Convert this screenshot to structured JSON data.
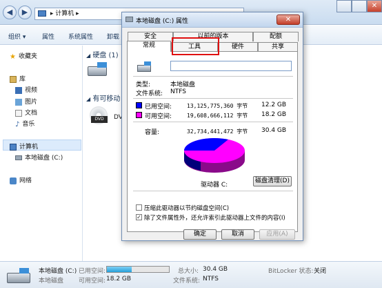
{
  "explorer": {
    "address": {
      "computer": "计算机",
      "chevron": "▸"
    },
    "toolbar": {
      "organize": "组织 ▾",
      "properties": "属性",
      "system_properties": "系统属性",
      "uninstall": "卸载"
    },
    "sidebar": {
      "favorites": "收藏夹",
      "libraries": "库",
      "lib_items": [
        "视频",
        "图片",
        "文档",
        "音乐"
      ],
      "computer": "计算机",
      "local_disk": "本地磁盘 (C:)",
      "network": "网络"
    },
    "content": {
      "hard_disks": "硬盘 (1)",
      "removable": "有可移动",
      "dvd_label": "DVD",
      "dvd_abbr": "DV"
    },
    "status": {
      "drive_name": "本地磁盘 (C:)",
      "drive_sub": "本地磁盘",
      "used_label": "已用空间:",
      "used_fraction": 0.4,
      "free_label": "可用空间:",
      "free_value": "18.2 GB",
      "total_label": "总大小:",
      "total_value": "30.4 GB",
      "fs_label": "文件系统:",
      "fs_value": "NTFS",
      "bitlocker_label": "BitLocker 状态:",
      "bitlocker_value": "关闭"
    }
  },
  "dialog": {
    "title": "本地磁盘 (C:) 属性",
    "close": "✕",
    "tabs_top": [
      "安全",
      "以前的版本",
      "配额"
    ],
    "tabs_bottom": [
      "常规",
      "工具",
      "硬件",
      "共享"
    ],
    "name_value": "",
    "type_label": "类型:",
    "type_value": "本地磁盘",
    "fs_label": "文件系统:",
    "fs_value": "NTFS",
    "used_label": "已用空间:",
    "used_bytes": "13,125,775,360 字节",
    "used_gb": "12.2 GB",
    "free_label": "可用空间:",
    "free_bytes": "19,608,666,112 字节",
    "free_gb": "18.2 GB",
    "capacity_label": "容量:",
    "capacity_bytes": "32,734,441,472 字节",
    "capacity_gb": "30.4 GB",
    "drive_label": "驱动器 C:",
    "cleanup_button": "磁盘清理(D)",
    "compress_label": "压缩此驱动器以节约磁盘空间(C)",
    "index_label": "除了文件属性外，还允许索引此驱动器上文件的内容(I)",
    "index_checked": "✓",
    "ok": "确定",
    "cancel": "取消",
    "apply": "应用(A)",
    "colors": {
      "used": "#0000ff",
      "free": "#ff00ff"
    }
  }
}
